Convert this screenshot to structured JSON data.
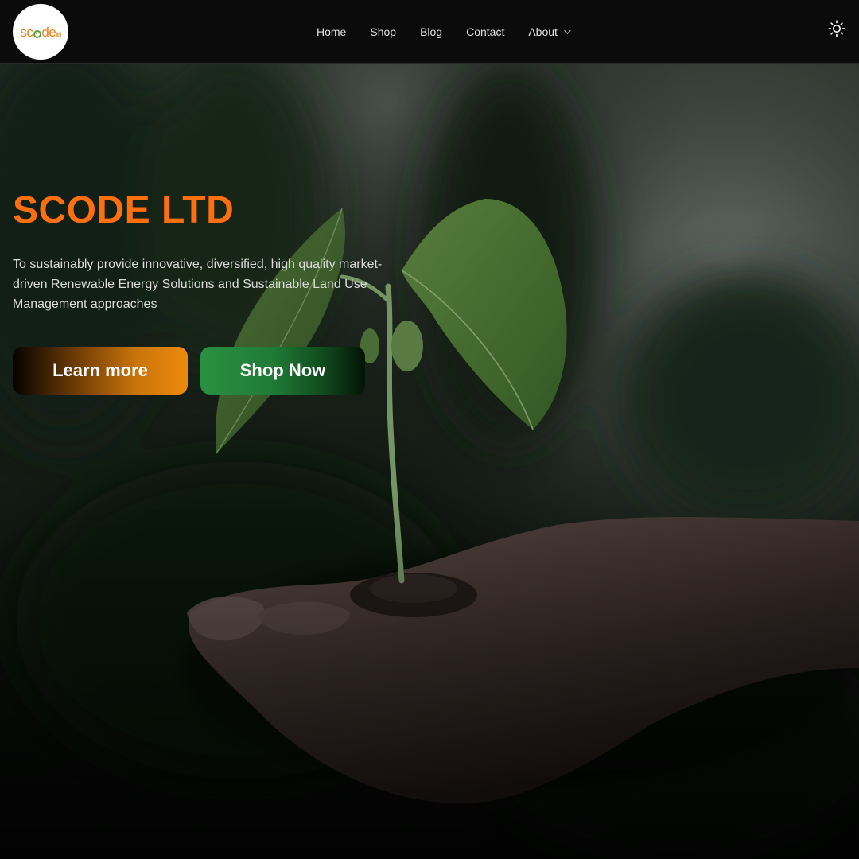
{
  "brand": {
    "logo_text": "sc",
    "logo_text_end": "de",
    "logo_suffix": "ltd",
    "logo_alt": "scode ltd"
  },
  "nav": {
    "items": [
      {
        "label": "Home"
      },
      {
        "label": "Shop"
      },
      {
        "label": "Blog"
      },
      {
        "label": "Contact"
      },
      {
        "label": "About",
        "has_dropdown": true
      }
    ],
    "theme_toggle_icon": "sun-icon"
  },
  "hero": {
    "title": "SCODE LTD",
    "description": "To sustainably provide innovative, diversified, high quality market-driven Renewable Energy Solutions and Sustainable Land Use Management approaches",
    "background_image": "seedling-in-hand",
    "buttons": {
      "learn_more": "Learn more",
      "shop_now": "Shop Now"
    }
  },
  "colors": {
    "accent_orange": "#ff6f0f",
    "accent_green": "#2a9142",
    "navbar_bg": "#0b0b0b"
  }
}
